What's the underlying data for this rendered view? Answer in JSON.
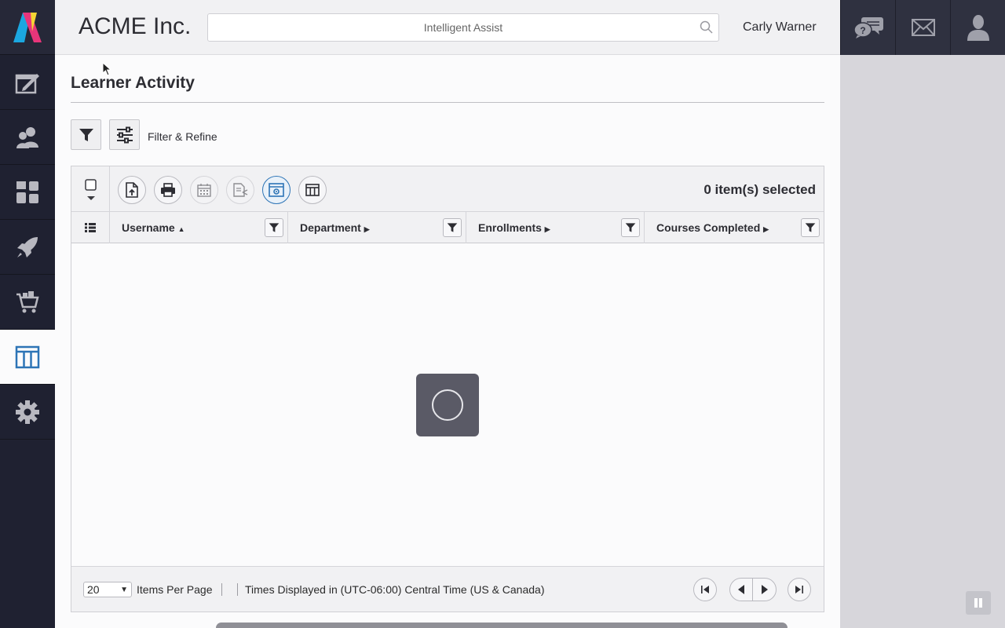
{
  "app": {
    "company_name": "ACME Inc.",
    "user_name": "Carly Warner"
  },
  "search": {
    "placeholder": "Intelligent Assist"
  },
  "sidebar": {
    "items": [
      {
        "icon": "edit-icon"
      },
      {
        "icon": "users-icon"
      },
      {
        "icon": "dashboard-icon"
      },
      {
        "icon": "rocket-icon"
      },
      {
        "icon": "cart-icon"
      },
      {
        "icon": "reports-table-icon",
        "active": true
      },
      {
        "icon": "gear-icon"
      }
    ]
  },
  "top_actions": [
    {
      "icon": "help-chat-icon"
    },
    {
      "icon": "mail-icon"
    },
    {
      "icon": "profile-icon"
    }
  ],
  "page": {
    "title": "Learner Activity",
    "filter_label": "Filter & Refine"
  },
  "grid": {
    "selected_count": "0 item(s) selected",
    "columns": [
      {
        "label": "Username",
        "sort": "asc"
      },
      {
        "label": "Department",
        "sort": "none"
      },
      {
        "label": "Enrollments",
        "sort": "none"
      },
      {
        "label": "Courses Completed",
        "sort": "none"
      }
    ],
    "loading": true
  },
  "footer": {
    "items_per_page_value": "20",
    "items_per_page_label": "Items Per Page",
    "timezone_text": "Times Displayed in (UTC-06:00) Central Time (US & Canada)"
  },
  "colors": {
    "sidebar_bg": "#1f2131",
    "accent": "#2d74b6",
    "spinner_bg": "#5a5a66"
  }
}
